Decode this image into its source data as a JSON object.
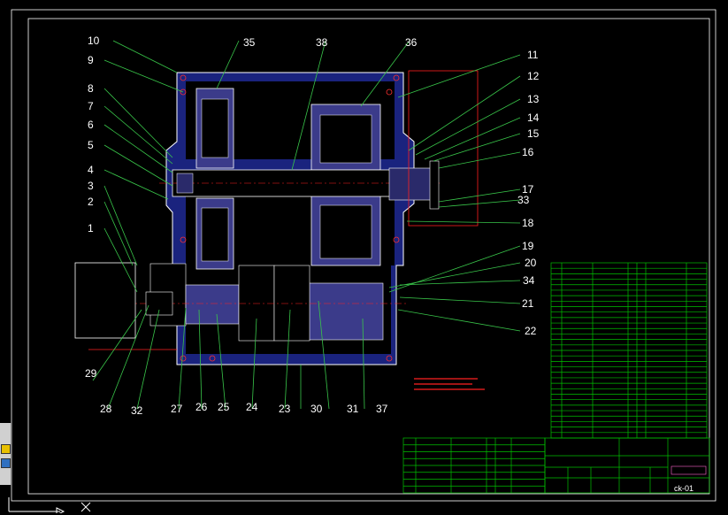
{
  "drawing": {
    "part_numbers": [
      "1",
      "2",
      "3",
      "4",
      "5",
      "6",
      "7",
      "8",
      "9",
      "10",
      "11",
      "12",
      "13",
      "14",
      "15",
      "16",
      "17",
      "18",
      "19",
      "20",
      "21",
      "22",
      "23",
      "24",
      "25",
      "26",
      "27",
      "28",
      "29",
      "30",
      "31",
      "32",
      "33",
      "34",
      "35",
      "36",
      "37",
      "38"
    ],
    "drawing_number": "ck-01"
  },
  "cad_toolbar": {
    "icons": [
      "ucs-icon",
      "layer-icon"
    ]
  },
  "colors": {
    "background": "#000000",
    "housing": "#1a237e",
    "outline": "#ffffff",
    "leader": "#39c64a",
    "frame": "#ffffff",
    "table_lines": "#00c000",
    "dimension": "#ff2020"
  }
}
